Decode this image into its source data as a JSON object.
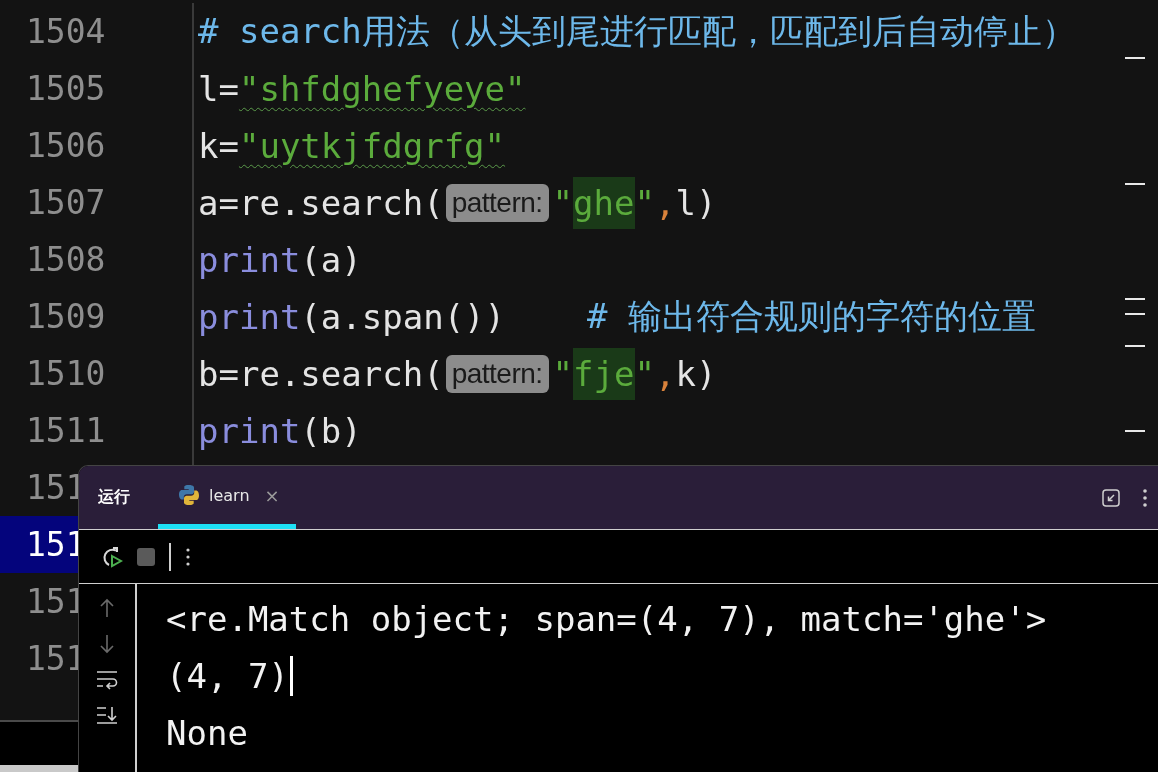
{
  "editor": {
    "lines": [
      {
        "number": "1504",
        "selected": false,
        "tokens": [
          {
            "kind": "comment",
            "text": "# search用法（从头到尾进行匹配，匹配到后自动停止）"
          }
        ]
      },
      {
        "number": "1505",
        "selected": false,
        "tokens": [
          {
            "kind": "text",
            "text": "l="
          },
          {
            "kind": "string-wavy",
            "text": "\"shfdghefyeye\""
          }
        ]
      },
      {
        "number": "1506",
        "selected": false,
        "tokens": [
          {
            "kind": "text",
            "text": "k="
          },
          {
            "kind": "string-wavy",
            "text": "\"uytkjfdgrfg\""
          }
        ]
      },
      {
        "number": "1507",
        "selected": false,
        "tokens": [
          {
            "kind": "text",
            "text": "a=re.search("
          },
          {
            "kind": "hint",
            "text": "pattern:"
          },
          {
            "kind": "string",
            "text": "\""
          },
          {
            "kind": "match",
            "text": "ghe"
          },
          {
            "kind": "string",
            "text": "\""
          },
          {
            "kind": "comma",
            "text": ","
          },
          {
            "kind": "text",
            "text": "l)"
          }
        ]
      },
      {
        "number": "1508",
        "selected": false,
        "tokens": [
          {
            "kind": "builtin",
            "text": "print"
          },
          {
            "kind": "text",
            "text": "(a)"
          }
        ]
      },
      {
        "number": "1509",
        "selected": false,
        "tokens": [
          {
            "kind": "builtin",
            "text": "print"
          },
          {
            "kind": "text",
            "text": "(a.span())    "
          },
          {
            "kind": "comment",
            "text": "# 输出符合规则的字符的位置"
          }
        ]
      },
      {
        "number": "1510",
        "selected": false,
        "tokens": [
          {
            "kind": "text",
            "text": "b=re.search("
          },
          {
            "kind": "hint",
            "text": "pattern:"
          },
          {
            "kind": "string",
            "text": "\""
          },
          {
            "kind": "match",
            "text": "fje"
          },
          {
            "kind": "string",
            "text": "\""
          },
          {
            "kind": "comma",
            "text": ","
          },
          {
            "kind": "text",
            "text": "k)"
          }
        ]
      },
      {
        "number": "1511",
        "selected": false,
        "tokens": [
          {
            "kind": "builtin",
            "text": "print"
          },
          {
            "kind": "text",
            "text": "(b)"
          }
        ]
      },
      {
        "number": "151",
        "selected": false
      },
      {
        "number": "151",
        "selected": true
      },
      {
        "number": "151",
        "selected": false
      },
      {
        "number": "151",
        "selected": false
      }
    ]
  },
  "run_panel": {
    "title": "运行",
    "tabs": [
      {
        "label": "learn",
        "close": "×",
        "selected": true
      }
    ],
    "console": [
      {
        "text": "<re.Match object; span=(4, 7), match='ghe'>",
        "cursor": false
      },
      {
        "text": "(4, 7)",
        "cursor": true
      },
      {
        "text": "None",
        "cursor": false
      }
    ]
  }
}
